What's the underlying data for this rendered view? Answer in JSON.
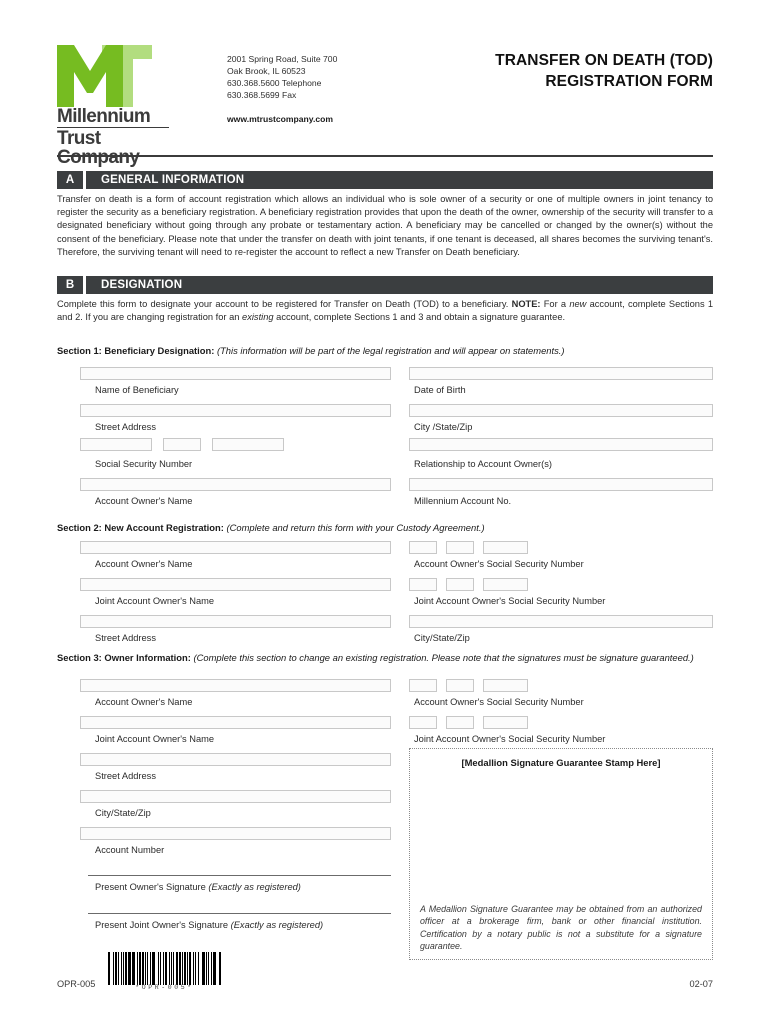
{
  "company": {
    "logo_alt": "Millennium Trust Company logo",
    "name_line1": "Millennium",
    "name_line2": "Trust Company",
    "logo_color_dark": "#76bc21",
    "logo_color_light": "#b2dd7f",
    "address_line1": "2001 Spring Road, Suite 700",
    "address_line2": "Oak Brook, IL 60523",
    "address_line3": "630.368.5600 Telephone",
    "address_line4": "630.368.5699 Fax",
    "website": "www.mtrustcompany.com"
  },
  "document": {
    "title_line1": "TRANSFER ON DEATH (TOD)",
    "title_line2": "REGISTRATION FORM"
  },
  "sections": {
    "a": {
      "letter": "A",
      "title": "GENERAL INFORMATION",
      "body": "Transfer on death is a form of account registration which allows an individual who is sole owner of a security or one of multiple owners in joint tenancy to register the security as a beneficiary registration.  A beneficiary registration provides that upon the death of the owner, ownership of the security will transfer to a designated beneficiary without going through any probate or testamentary action.  A beneficiary may be cancelled or changed by the owner(s) without the consent of the beneficiary.  Please note that under the transfer on death with joint tenants, if one tenant is deceased, all shares becomes the surviving tenant's. Therefore, the surviving tenant will need to re-register the account to reflect a new Transfer on Death beneficiary."
    },
    "b": {
      "letter": "B",
      "title": "DESIGNATION",
      "body_part1": "Complete this form to designate your account to be registered for Transfer on Death (TOD) to a beneficiary.  ",
      "body_note": "NOTE:",
      "body_part2": " For a ",
      "body_italic1": "new",
      "body_part3": " account, complete Sections 1 and 2.  If you are changing registration for an ",
      "body_italic2": "existing",
      "body_part4": " account, complete Sections 1 and 3 and obtain a signature guarantee."
    }
  },
  "section1": {
    "heading_label": "Section 1: Beneficiary Designation:",
    "heading_note": "(This information will be part of the legal registration and will appear on statements.)",
    "fields": {
      "name_of_beneficiary": "Name of Beneficiary",
      "date_of_birth": "Date of Birth",
      "street_address": "Street Address",
      "city_state_zip": "City /State/Zip",
      "social_security_number": "Social Security Number",
      "relationship": "Relationship to Account Owner(s)",
      "account_owners_name": "Account Owner's Name",
      "millennium_account_no": "Millennium Account No."
    }
  },
  "section2": {
    "heading_label": "Section 2: New Account Registration:",
    "heading_note": "(Complete and return this form with your Custody Agreement.)",
    "fields": {
      "account_owners_name": "Account Owner's Name",
      "account_owners_ssn": "Account Owner's Social Security Number",
      "joint_account_owners_name": "Joint Account Owner's  Name",
      "joint_account_owners_ssn": "Joint Account Owner's Social Security Number",
      "street_address": "Street Address",
      "city_state_zip": "City/State/Zip"
    }
  },
  "section3": {
    "heading_label": "Section 3: Owner Information:",
    "heading_note": "(Complete this section to change an existing registration.  Please note that the signatures must be signature guaranteed.)",
    "fields": {
      "account_owners_name": "Account Owner's Name",
      "account_owners_ssn": "Account Owner's Social Security Number",
      "joint_account_owners_name": "Joint Account Owner's  Name",
      "joint_account_owners_ssn": "Joint Account Owner's Social Security Number",
      "street_address": "Street Address",
      "city_state_zip": "City/State/Zip",
      "account_number": "Account Number",
      "present_owner_signature": "Present Owner's Signature",
      "present_owner_signature_note": "(Exactly as registered)",
      "present_joint_owner_signature": "Present Joint Owner's Signature",
      "present_joint_owner_signature_note": "(Exactly as registered)"
    }
  },
  "medallion": {
    "stamp_title": "[Medallion Signature Guarantee Stamp Here]",
    "note": "A Medallion Signature Guarantee may be obtained from an authorized officer at a brokerage firm, bank or other financial institution. Certification by a notary public is not a substitute for a signature guarantee."
  },
  "footer": {
    "form_code": "OPR-005",
    "barcode_text": "*OPR-005*",
    "revision_date": "02-07"
  }
}
